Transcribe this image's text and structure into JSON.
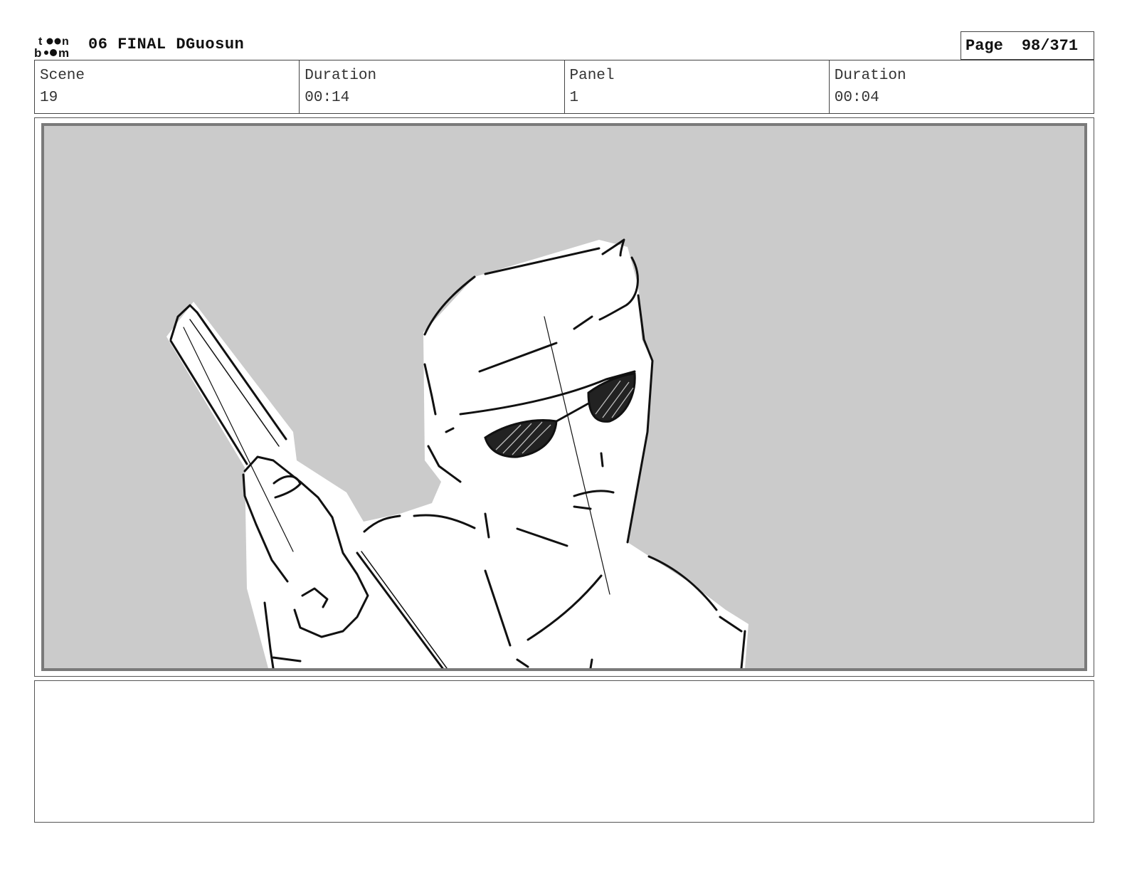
{
  "header": {
    "logo_text": "toon boom",
    "project_title": "06 FINAL DGuosun",
    "page_label": "Page",
    "page_number": "98/371"
  },
  "info": [
    {
      "label": "Scene",
      "value": "19"
    },
    {
      "label": "Duration",
      "value": "00:14"
    },
    {
      "label": "Panel",
      "value": "1"
    },
    {
      "label": "Duration",
      "value": "00:04"
    }
  ],
  "panel": {
    "description": "",
    "background_color": "#cbcbcb"
  },
  "notes": ""
}
